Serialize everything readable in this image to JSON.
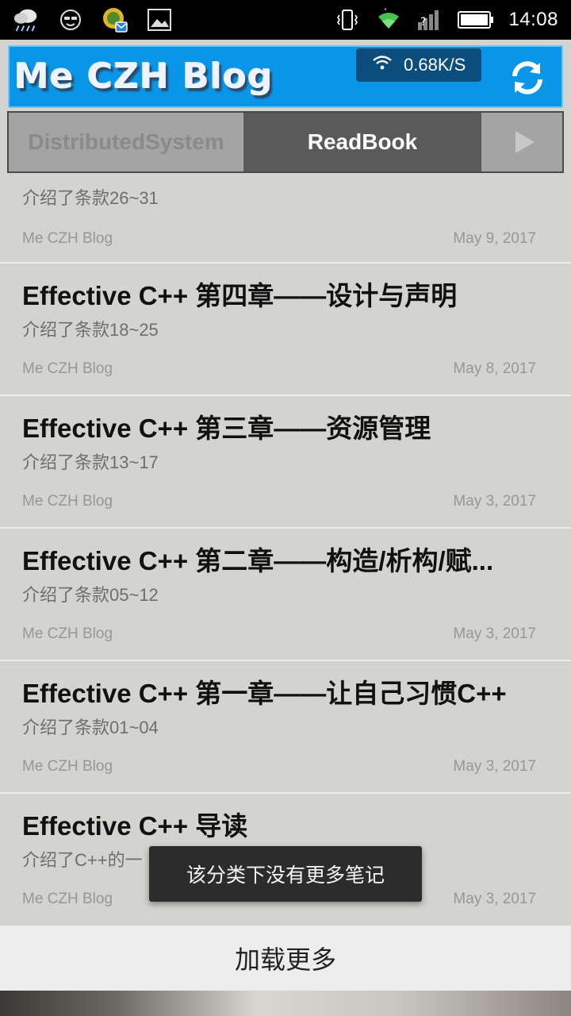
{
  "status_bar": {
    "time": "14:08",
    "left_icons": [
      "weather-rain-icon",
      "face-icon",
      "app-badge-icon",
      "image-icon"
    ],
    "right_icons": [
      "vibrate-icon",
      "wifi-icon",
      "signal-icon",
      "battery-icon"
    ]
  },
  "header": {
    "title": "Me CZH Blog",
    "network_speed": "0.68K/S",
    "accent_color": "#0a96e8"
  },
  "tabs": {
    "items": [
      {
        "label": "DistributedSystem",
        "active": false
      },
      {
        "label": "ReadBook",
        "active": true
      }
    ],
    "next_icon": "play-arrow-icon"
  },
  "partial_item": {
    "desc": "介绍了条款26~31",
    "author": "Me CZH Blog",
    "date": "May 9, 2017"
  },
  "posts": [
    {
      "title": "Effective C++ 第四章——设计与声明",
      "desc": "介绍了条款18~25",
      "author": "Me CZH Blog",
      "date": "May 8, 2017"
    },
    {
      "title": "Effective C++ 第三章——资源管理",
      "desc": "介绍了条款13~17",
      "author": "Me CZH Blog",
      "date": "May 3, 2017"
    },
    {
      "title": "Effective C++ 第二章——构造/析构/赋...",
      "desc": "介绍了条款05~12",
      "author": "Me CZH Blog",
      "date": "May 3, 2017"
    },
    {
      "title": "Effective C++ 第一章——让自己习惯C++",
      "desc": "介绍了条款01~04",
      "author": "Me CZH Blog",
      "date": "May 3, 2017"
    },
    {
      "title": "Effective C++ 导读",
      "desc": "介绍了C++的一",
      "author": "Me CZH Blog",
      "date": "May 3, 2017"
    }
  ],
  "toast": "该分类下没有更多笔记",
  "load_more": "加载更多"
}
